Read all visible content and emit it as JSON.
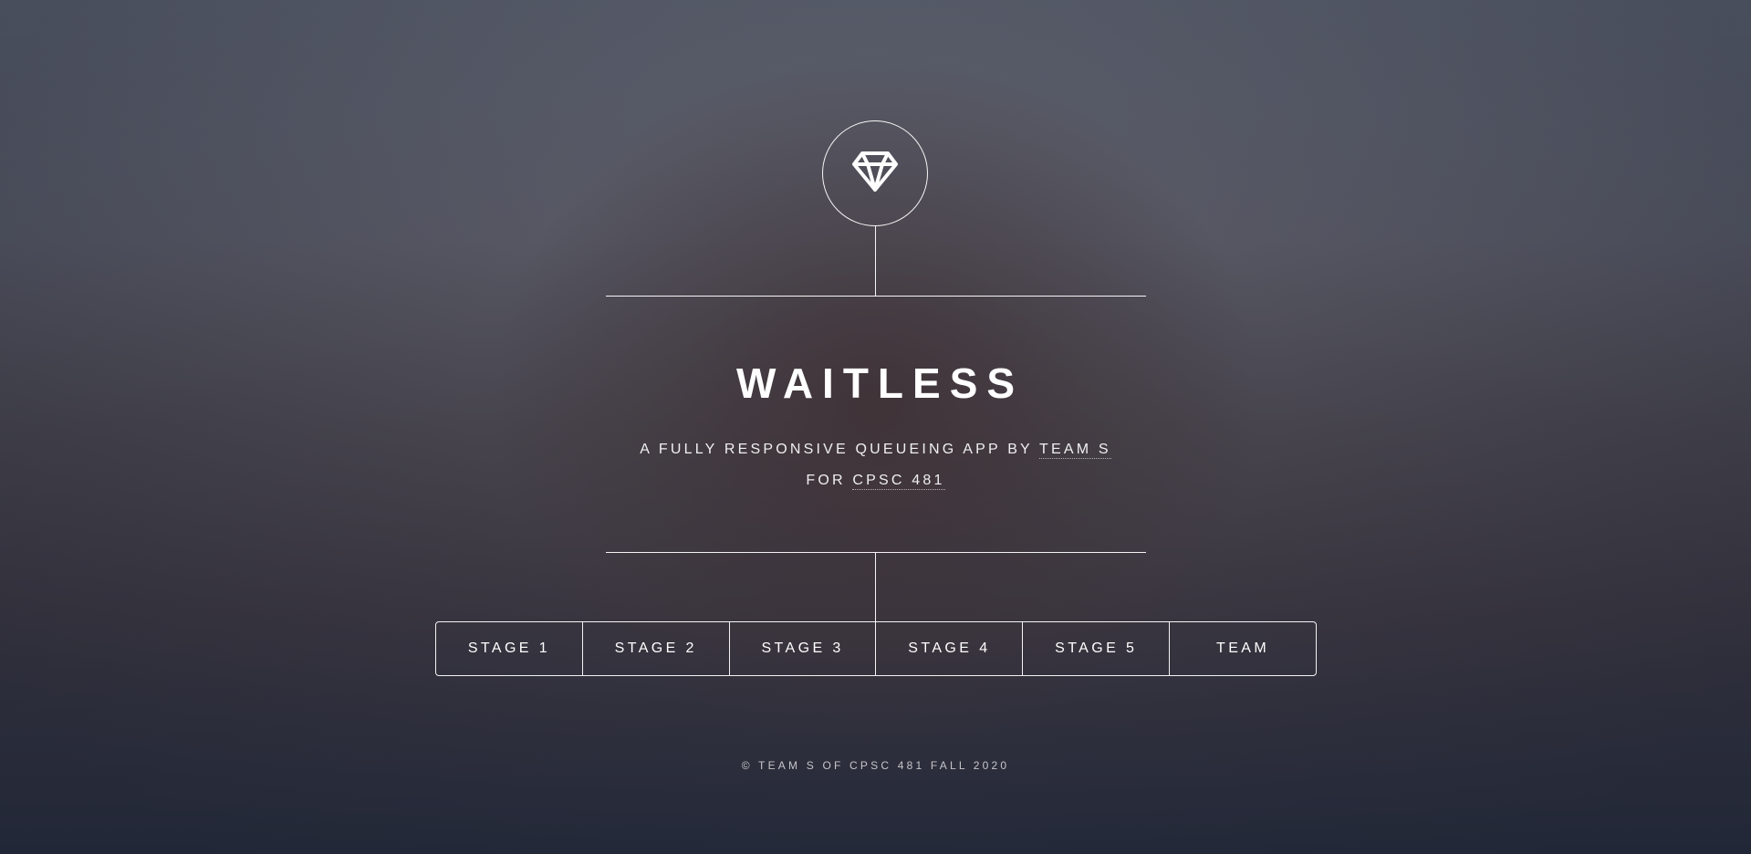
{
  "header": {
    "logo_icon": "diamond-icon",
    "title": "WAITLESS"
  },
  "intro": {
    "line1_prefix": "A FULLY RESPONSIVE QUEUEING APP BY ",
    "line1_link": "TEAM S",
    "line2_prefix": "FOR ",
    "line2_link": "CPSC 481"
  },
  "nav": {
    "items": [
      {
        "label": "STAGE 1"
      },
      {
        "label": "STAGE 2"
      },
      {
        "label": "STAGE 3"
      },
      {
        "label": "STAGE 4"
      },
      {
        "label": "STAGE 5"
      },
      {
        "label": "TEAM"
      }
    ]
  },
  "footer": {
    "copyright": "© TEAM S OF CPSC 481 FALL 2020"
  },
  "colors": {
    "text": "#ffffff",
    "lines": "#ffffff"
  }
}
